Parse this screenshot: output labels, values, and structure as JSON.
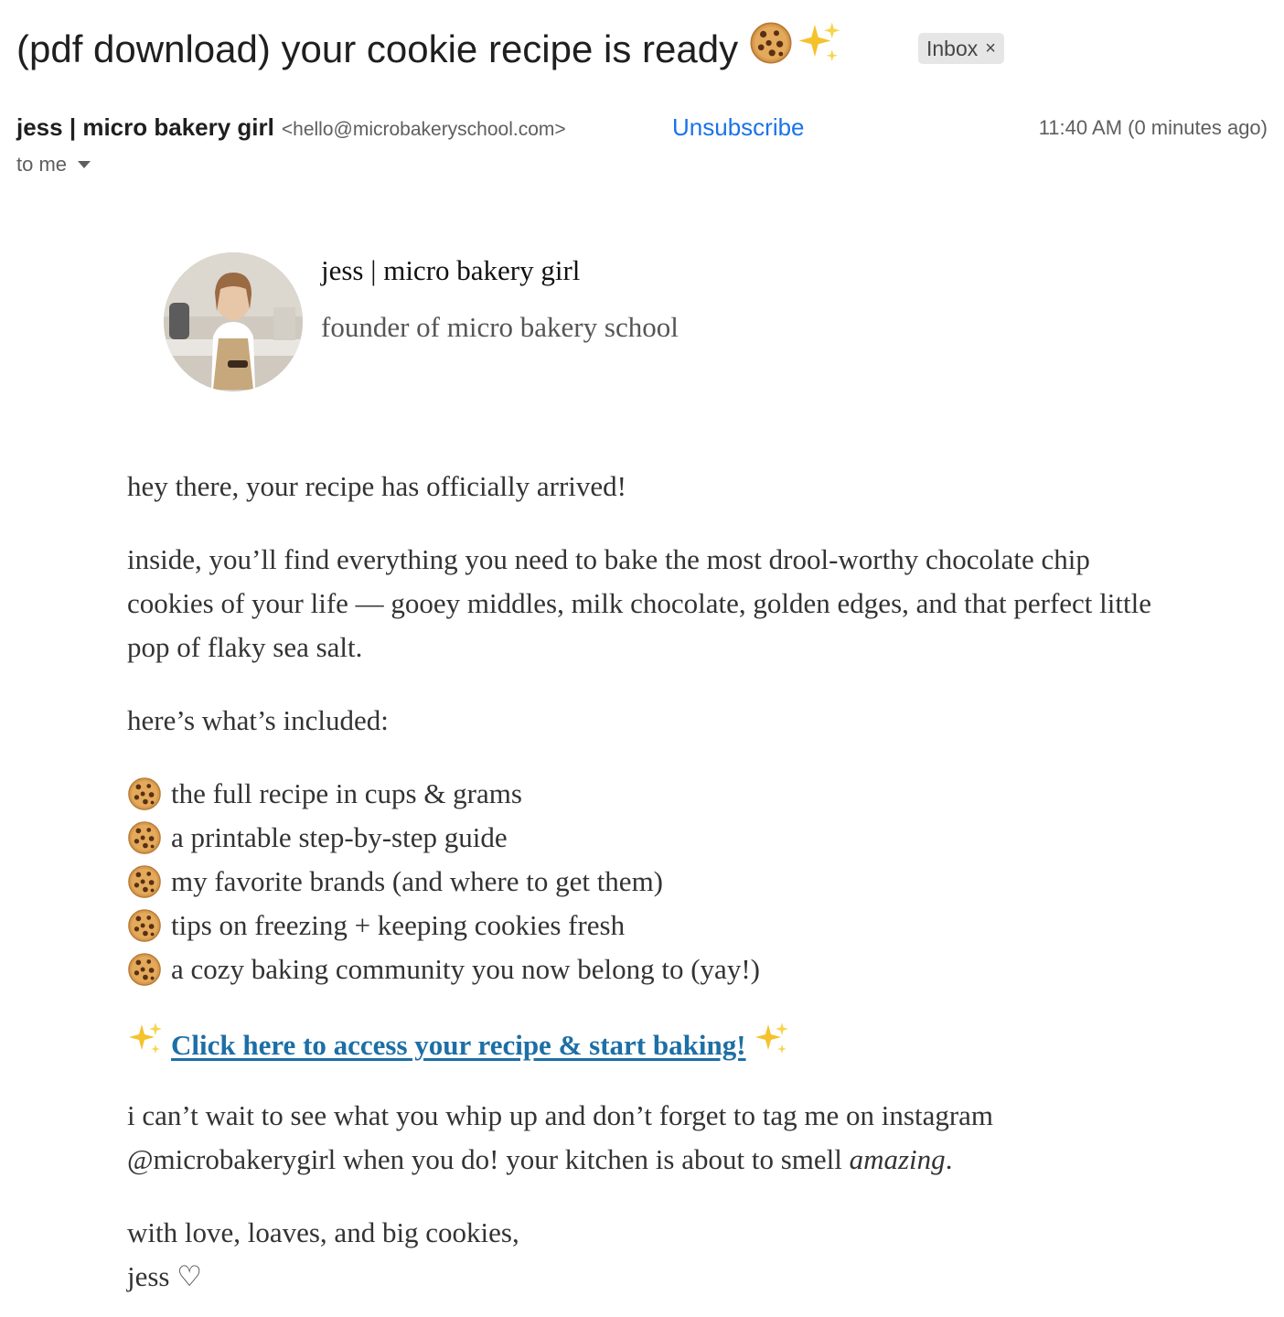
{
  "email": {
    "subject": "(pdf download) your cookie recipe is ready",
    "subject_emoji": [
      "cookie-emoji",
      "sparkles-emoji"
    ],
    "label": "Inbox",
    "label_remove": "×",
    "sender_name": "jess | micro bakery girl",
    "sender_email": "<hello@microbakeryschool.com>",
    "unsubscribe": "Unsubscribe",
    "timestamp": "11:40 AM (0 minutes ago)",
    "recipient": "to me"
  },
  "card": {
    "name": "jess | micro bakery girl",
    "role": "founder of micro bakery school"
  },
  "body": {
    "greeting": "hey there, your recipe has officially arrived!",
    "intro": "inside, you’ll find everything you need to bake the most drool-worthy chocolate chip cookies of your life — gooey middles, milk chocolate, golden edges, and that perfect little pop of flaky sea salt.",
    "included_heading": "here’s what’s included:",
    "included_items": [
      "the full recipe in cups & grams",
      "a printable step-by-step guide",
      "my favorite brands (and where to get them)",
      "tips on freezing + keeping cookies fresh",
      "a cozy baking community you now belong to (yay!)"
    ],
    "cta": "Click here to access your recipe & start baking!",
    "closing_before": "i can’t wait to see what you whip up and don’t forget to tag me on instagram @microbakerygirl when you do! your kitchen is about to smell ",
    "closing_emphasis": "amazing",
    "closing_after": ".",
    "signoff": "with love, loaves, and big cookies,",
    "signature": "jess ♡"
  },
  "colors": {
    "link": "#1d6fa5",
    "unsubscribe": "#1a73e8",
    "cookie": "#c98a3e",
    "chip": "#6b3a1e",
    "sparkle": "#f4c22b"
  }
}
